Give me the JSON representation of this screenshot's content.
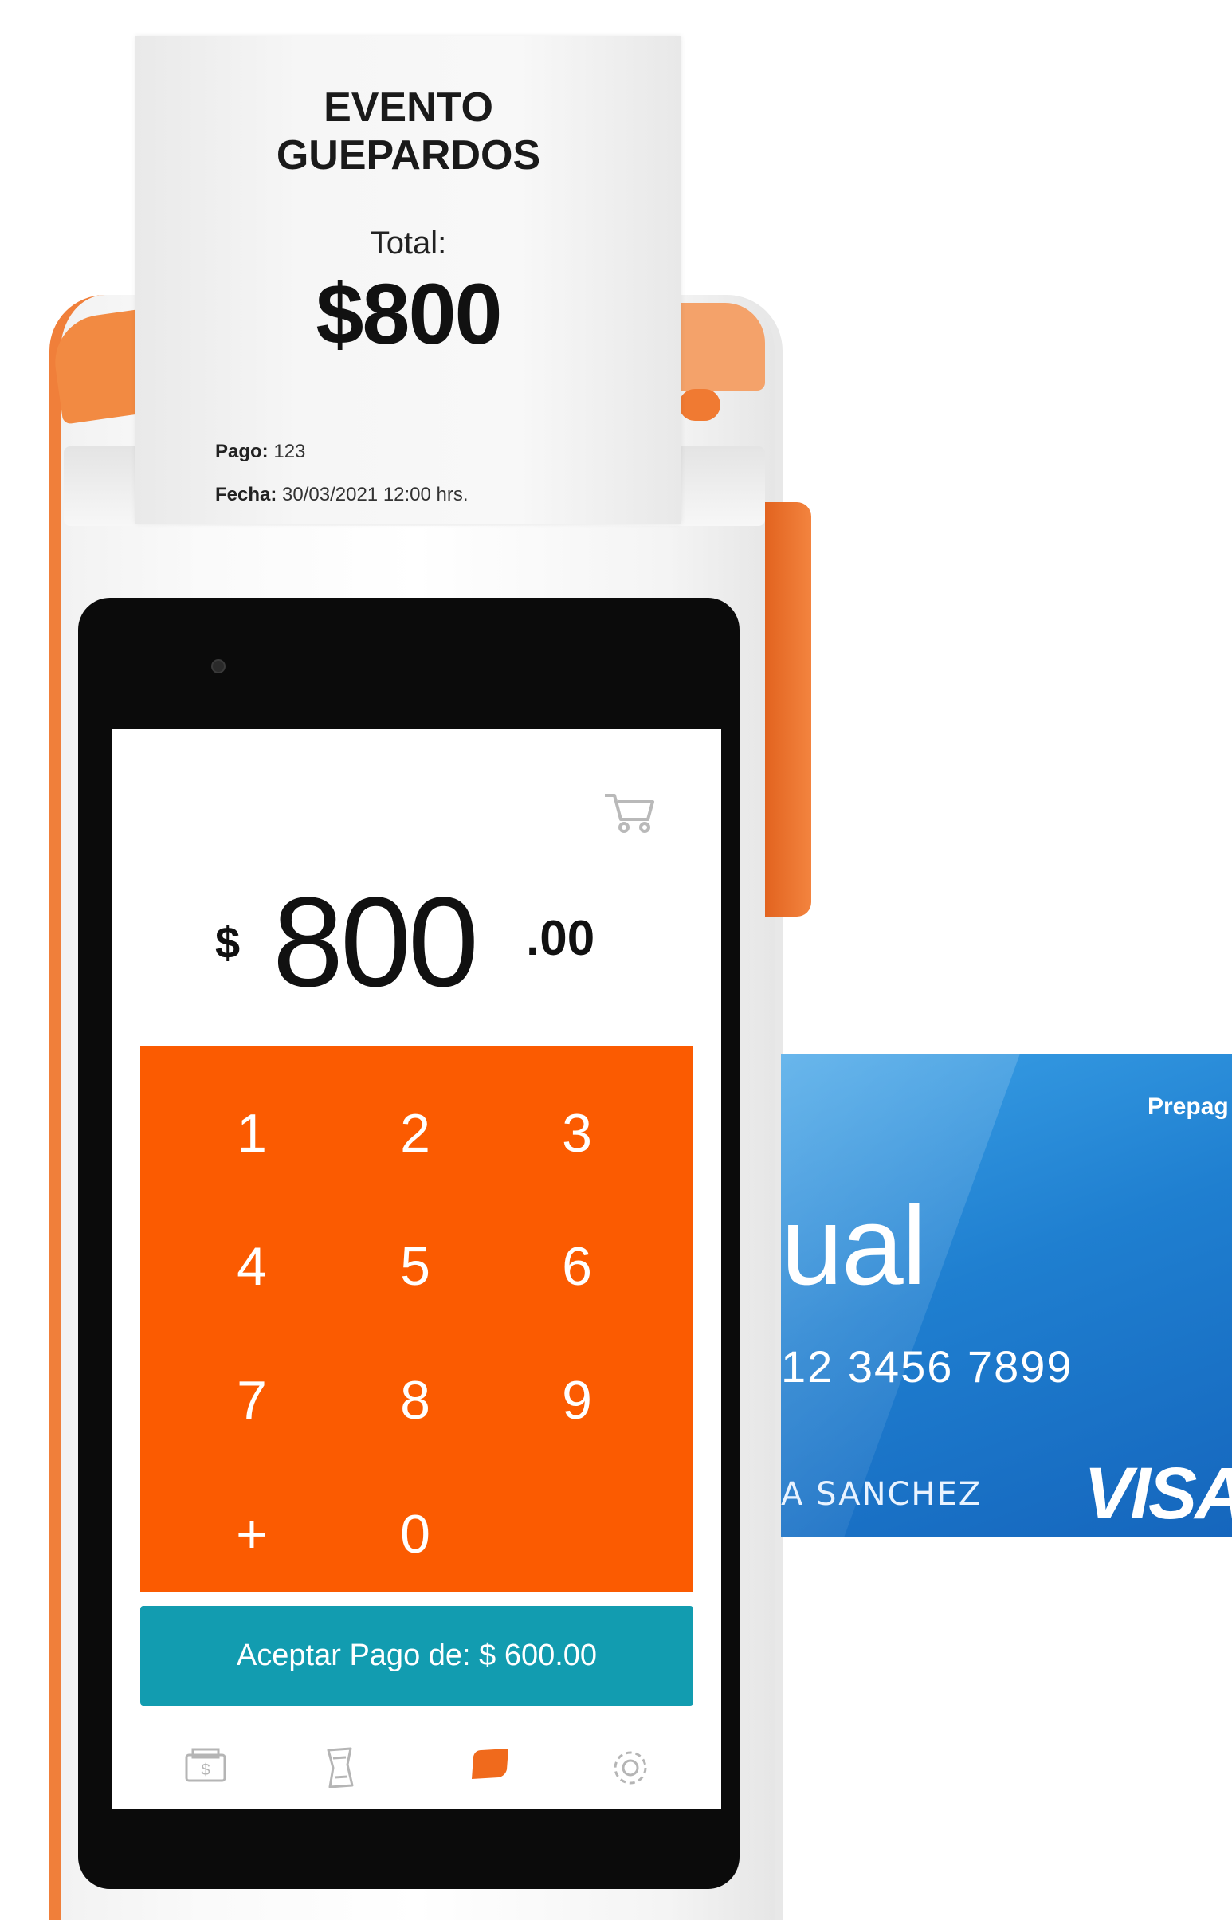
{
  "receipt": {
    "title_line1": "EVENTO",
    "title_line2": "GUEPARDOS",
    "total_label": "Total:",
    "total_value": "$800",
    "pago_label": "Pago:",
    "pago_value": "123",
    "fecha_label": "Fecha:",
    "fecha_value": "30/03/2021 12:00 hrs."
  },
  "screen": {
    "currency": "$",
    "amount": "800",
    "cents": ".00",
    "keys": [
      "1",
      "2",
      "3",
      "4",
      "5",
      "6",
      "7",
      "8",
      "9",
      "+",
      "0"
    ],
    "accept_button": "Aceptar Pago de: $ 600.00",
    "nav_icons": [
      "cash-icon",
      "receipt-icon",
      "card-icon",
      "gear-icon"
    ],
    "colors": {
      "keypad": "#fb5b01",
      "accept": "#129cb0",
      "device_accent": "#f07f3a"
    }
  },
  "card": {
    "label": "Prepag",
    "brand": "ual",
    "number": "12 3456 7899",
    "holder": "A SANCHEZ",
    "network": "VISA"
  }
}
